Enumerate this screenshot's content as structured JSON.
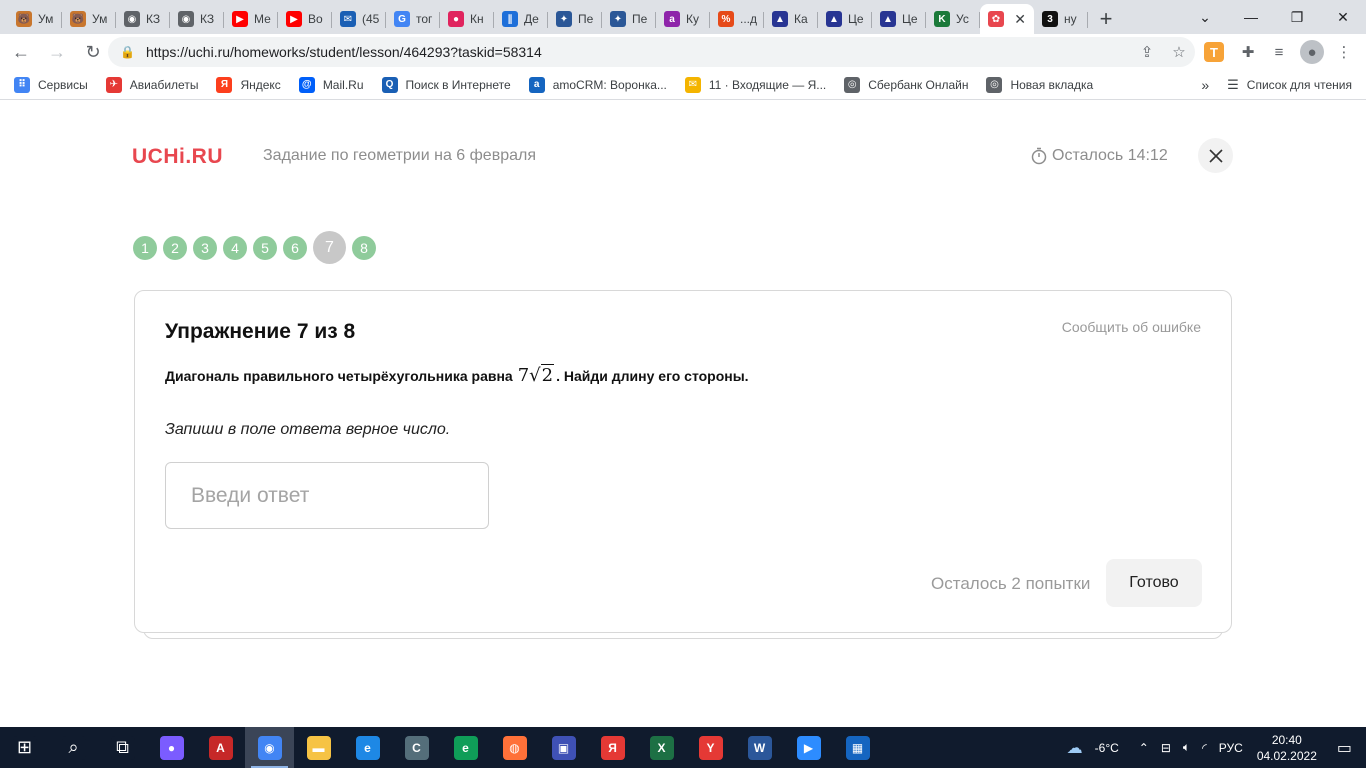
{
  "browser": {
    "tabs": [
      {
        "label": "Ум",
        "color": "#c8762e",
        "glyph": "🐻"
      },
      {
        "label": "Ум",
        "color": "#c8762e",
        "glyph": "🐻"
      },
      {
        "label": "КЗ",
        "color": "#5f6368",
        "glyph": "◉"
      },
      {
        "label": "КЗ",
        "color": "#5f6368",
        "glyph": "◉"
      },
      {
        "label": "Ме",
        "color": "#ff0000",
        "glyph": "▶"
      },
      {
        "label": "Во",
        "color": "#ff0000",
        "glyph": "▶"
      },
      {
        "label": "(45",
        "color": "#1a5fb4",
        "glyph": "✉"
      },
      {
        "label": "тог",
        "color": "#4285f4",
        "glyph": "G"
      },
      {
        "label": "Кн",
        "color": "#e0245e",
        "glyph": "●"
      },
      {
        "label": "Де",
        "color": "#1e6fd9",
        "glyph": "∥"
      },
      {
        "label": "Пе",
        "color": "#2b5797",
        "glyph": "✦"
      },
      {
        "label": "Пе",
        "color": "#2b5797",
        "glyph": "✦"
      },
      {
        "label": "Ку",
        "color": "#8e24aa",
        "glyph": "a"
      },
      {
        "label": "...д",
        "color": "#e64a19",
        "glyph": "%"
      },
      {
        "label": "Ка",
        "color": "#283593",
        "glyph": "▲"
      },
      {
        "label": "Це",
        "color": "#283593",
        "glyph": "▲"
      },
      {
        "label": "Це",
        "color": "#283593",
        "glyph": "▲"
      },
      {
        "label": "Ус",
        "color": "#1b7a3a",
        "glyph": "K"
      },
      {
        "label": "",
        "color": "#e8474f",
        "glyph": "✿",
        "active": true
      },
      {
        "label": "ну",
        "color": "#111111",
        "glyph": "3"
      }
    ],
    "url": "https://uchi.ru/homeworks/student/lesson/464293?taskid=58314",
    "bookmarks": [
      {
        "label": "Сервисы",
        "color": "#4285f4",
        "glyph": "⠿"
      },
      {
        "label": "Авиабилеты",
        "color": "#e53935",
        "glyph": "✈"
      },
      {
        "label": "Яндекс",
        "color": "#fc3f1d",
        "glyph": "Я"
      },
      {
        "label": "Mail.Ru",
        "color": "#005ff9",
        "glyph": "@"
      },
      {
        "label": "Поиск в Интернете",
        "color": "#1a5fb4",
        "glyph": "Q"
      },
      {
        "label": "amoCRM: Воронка...",
        "color": "#1565c0",
        "glyph": "a"
      },
      {
        "label": "11 · Входящие — Я...",
        "color": "#f4b400",
        "glyph": "✉"
      },
      {
        "label": "Сбербанк Онлайн",
        "color": "#5f6368",
        "glyph": "◎"
      },
      {
        "label": "Новая вкладка",
        "color": "#5f6368",
        "glyph": "◎"
      }
    ],
    "reading_list": "Список для чтения"
  },
  "page": {
    "logo": "UCHi.RU",
    "lesson_title": "Задание по геометрии на 6 февраля",
    "timer": "Осталось 14:12",
    "steps": [
      "1",
      "2",
      "3",
      "4",
      "5",
      "6",
      "7",
      "8"
    ],
    "current_step": 7,
    "exercise_title": "Упражнение 7 из 8",
    "report_error": "Сообщить об ошибке",
    "question_before": "Диагональ правильного четырёхугольника равна",
    "question_math_coef": "7",
    "question_math_root": "2",
    "question_after": ". Найди длину его стороны.",
    "hint": "Запиши в поле ответа верное число.",
    "answer_placeholder": "Введи ответ",
    "attempts": "Осталось 2 попытки",
    "done_label": "Готово"
  },
  "taskbar": {
    "icons": [
      {
        "name": "start",
        "color": "#101b2d",
        "glyph": "⊞"
      },
      {
        "name": "search",
        "color": "#101b2d",
        "glyph": "⌕"
      },
      {
        "name": "task-view",
        "color": "#101b2d",
        "glyph": "⧉"
      },
      {
        "name": "alice",
        "color": "#7b5cff",
        "glyph": "●"
      },
      {
        "name": "acrobat",
        "color": "#c62828",
        "glyph": "A"
      },
      {
        "name": "chrome",
        "color": "#4285f4",
        "glyph": "◉",
        "active": true
      },
      {
        "name": "explorer",
        "color": "#f6c344",
        "glyph": "▬"
      },
      {
        "name": "ie",
        "color": "#1e88e5",
        "glyph": "e"
      },
      {
        "name": "ccleaner",
        "color": "#546e7a",
        "glyph": "C"
      },
      {
        "name": "edge",
        "color": "#0f9d58",
        "glyph": "e"
      },
      {
        "name": "firefox",
        "color": "#ff7139",
        "glyph": "◍"
      },
      {
        "name": "device-manager",
        "color": "#3f51b5",
        "glyph": "▣"
      },
      {
        "name": "yandex",
        "color": "#e53935",
        "glyph": "Я"
      },
      {
        "name": "excel",
        "color": "#1d7044",
        "glyph": "X"
      },
      {
        "name": "yandex-browser",
        "color": "#e53935",
        "glyph": "Y"
      },
      {
        "name": "word",
        "color": "#2b579a",
        "glyph": "W"
      },
      {
        "name": "zoom",
        "color": "#2d8cff",
        "glyph": "▶"
      },
      {
        "name": "calculator",
        "color": "#1565c0",
        "glyph": "▦"
      }
    ],
    "weather": "-6°C",
    "language": "РУС",
    "time": "20:40",
    "date": "04.02.2022"
  }
}
